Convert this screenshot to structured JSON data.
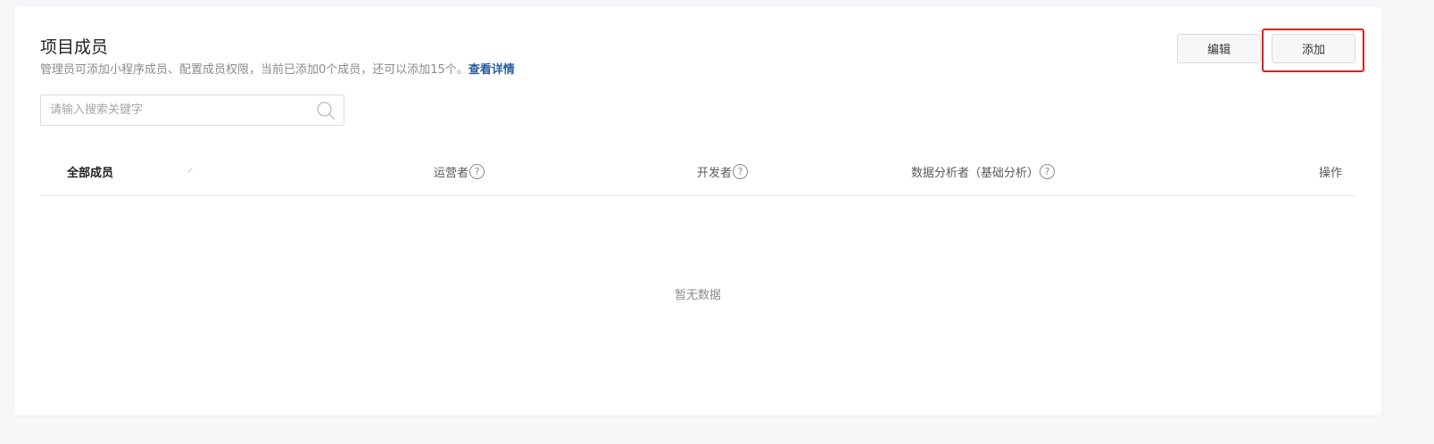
{
  "header": {
    "title": "项目成员",
    "description": "管理员可添加小程序成员、配置成员权限，当前已添加0个成员，还可以添加15个。",
    "detail_link": "查看详情"
  },
  "toolbar": {
    "edit_label": "编辑",
    "add_label": "添加"
  },
  "search": {
    "placeholder": "请输入搜索关键字",
    "value": ""
  },
  "table": {
    "columns": {
      "all_members": "全部成员",
      "operator": "运营者",
      "developer": "开发者",
      "data_analyst": "数据分析者（基础分析）",
      "actions": "操作"
    },
    "help_glyph": "?",
    "rows": [],
    "empty_text": "暂无数据"
  },
  "colors": {
    "highlight": "#e31b1b",
    "link": "#2a5d9f"
  }
}
